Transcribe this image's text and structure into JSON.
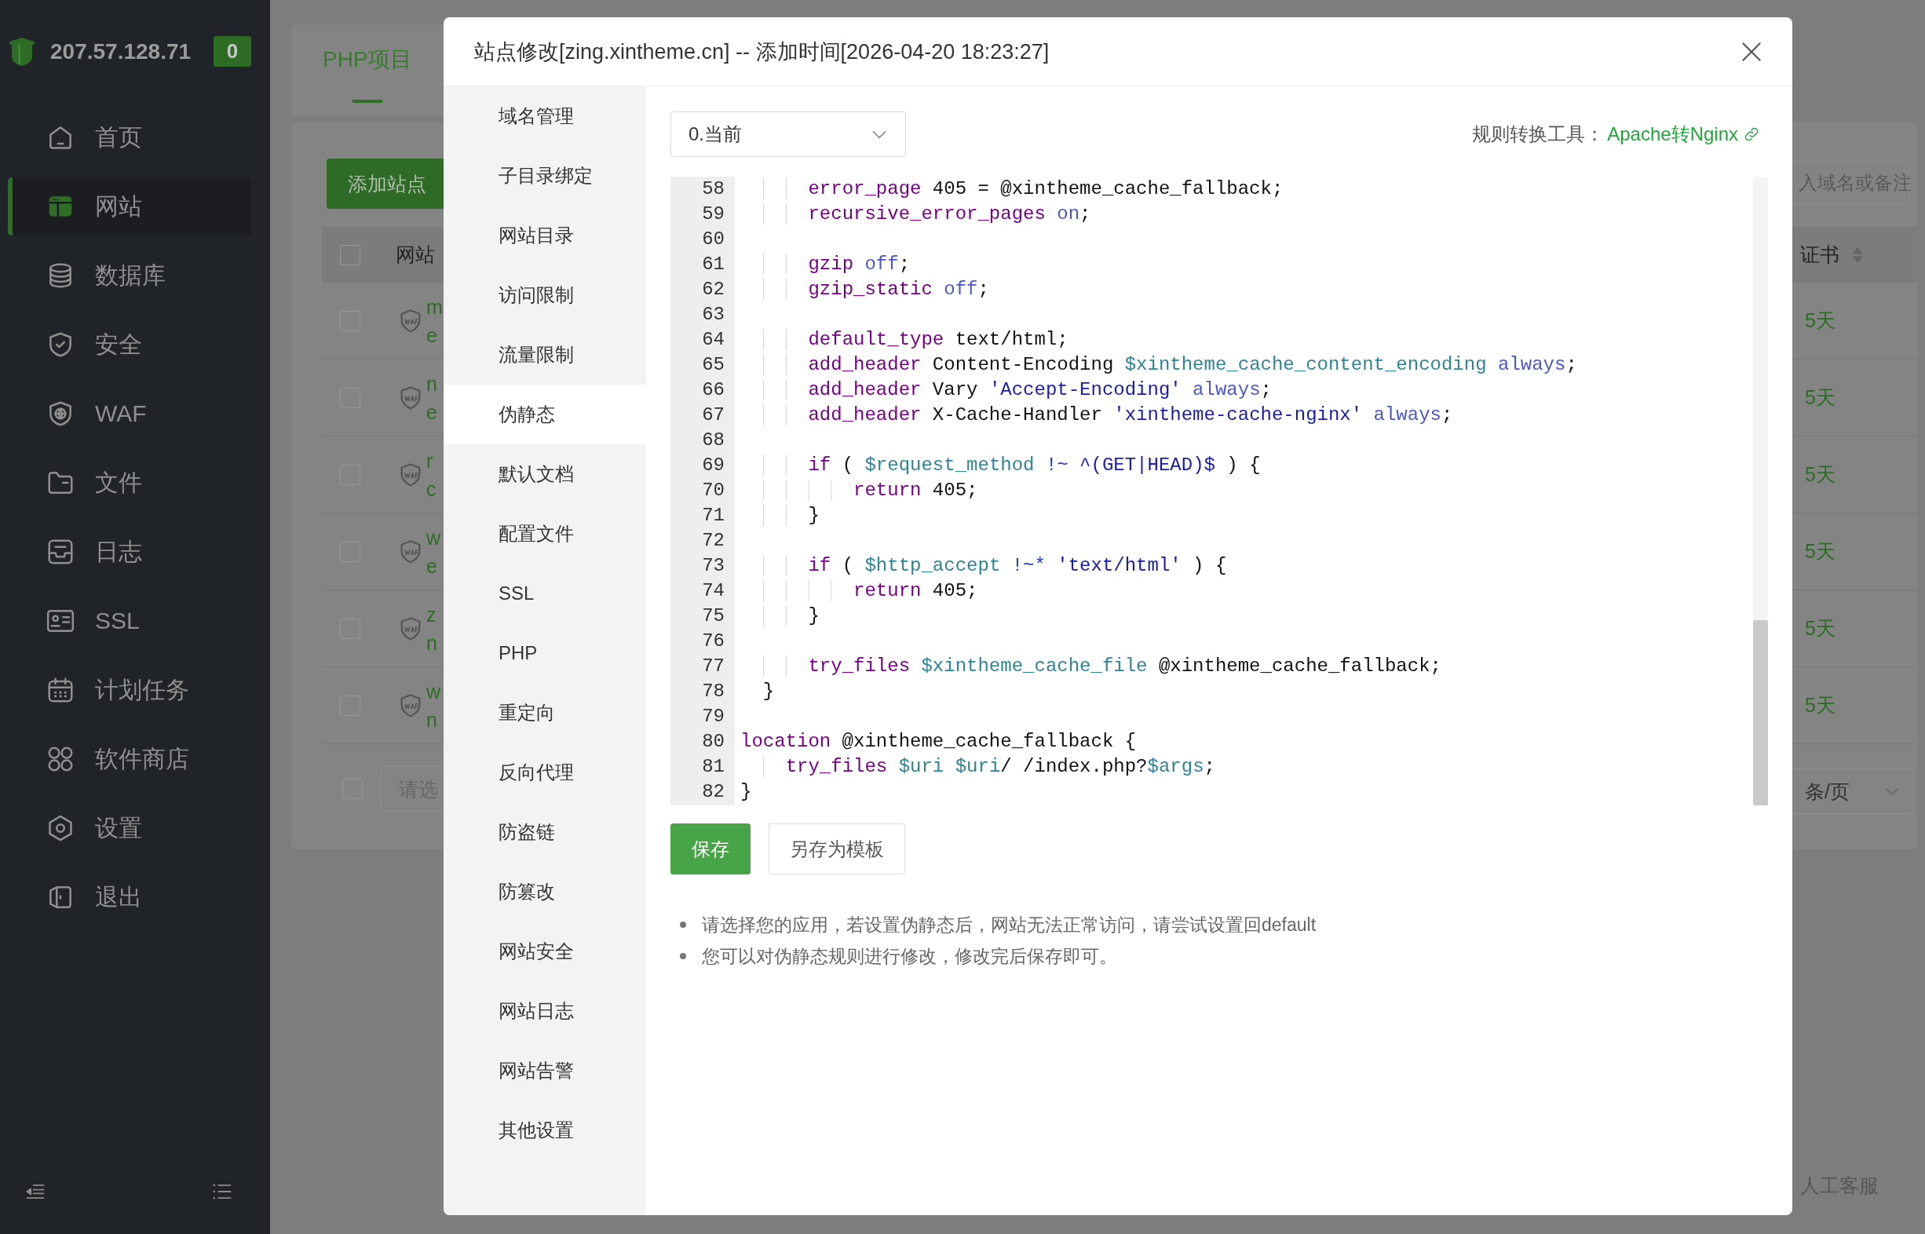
{
  "sidebar": {
    "server": "207.57.128.71",
    "badge": "0",
    "items": [
      {
        "label": "首页",
        "kind": "home",
        "selected": false
      },
      {
        "label": "网站",
        "kind": "site",
        "selected": true
      },
      {
        "label": "数据库",
        "kind": "database",
        "selected": false
      },
      {
        "label": "安全",
        "kind": "security",
        "selected": false
      },
      {
        "label": "WAF",
        "kind": "waf",
        "selected": false
      },
      {
        "label": "文件",
        "kind": "folder",
        "selected": false
      },
      {
        "label": "日志",
        "kind": "log",
        "selected": false
      },
      {
        "label": "SSL",
        "kind": "ssl",
        "selected": false
      },
      {
        "label": "计划任务",
        "kind": "calendar",
        "selected": false
      },
      {
        "label": "软件商店",
        "kind": "apps",
        "selected": false
      },
      {
        "label": "设置",
        "kind": "settings",
        "selected": false
      },
      {
        "label": "退出",
        "kind": "logout",
        "selected": false
      }
    ]
  },
  "background": {
    "tabs": [
      {
        "label": "PHP项目",
        "selected": true
      }
    ],
    "add_button": "添加站点",
    "search": {
      "placeholder": "入域名或备注"
    },
    "table": {
      "columns": [
        "网站",
        "证书"
      ],
      "header_checked": false,
      "rows": [
        {
          "name": "m",
          "note": "e",
          "ssl": "5天",
          "checked": false
        },
        {
          "name": "n",
          "note": "e",
          "ssl": "5天",
          "checked": false
        },
        {
          "name": "r",
          "note": "c",
          "ssl": "5天",
          "checked": false
        },
        {
          "name": "w",
          "note": "e",
          "ssl": "5天",
          "checked": false
        },
        {
          "name": "z",
          "note": "n",
          "ssl": "5天",
          "checked": false
        },
        {
          "name": "w",
          "note": "n",
          "ssl": "5天",
          "checked": false
        }
      ]
    },
    "batch": {
      "checked": false,
      "placeholder": "请选"
    },
    "page_size": "条/页",
    "support": "人工客服"
  },
  "modal": {
    "title": "站点修改[zing.xintheme.cn] -- 添加时间[2026-04-20 18:23:27]",
    "nav": [
      {
        "label": "域名管理",
        "selected": false
      },
      {
        "label": "子目录绑定",
        "selected": false
      },
      {
        "label": "网站目录",
        "selected": false
      },
      {
        "label": "访问限制",
        "selected": false
      },
      {
        "label": "流量限制",
        "selected": false
      },
      {
        "label": "伪静态",
        "selected": true
      },
      {
        "label": "默认文档",
        "selected": false
      },
      {
        "label": "配置文件",
        "selected": false
      },
      {
        "label": "SSL",
        "selected": false
      },
      {
        "label": "PHP",
        "selected": false
      },
      {
        "label": "重定向",
        "selected": false
      },
      {
        "label": "反向代理",
        "selected": false
      },
      {
        "label": "防盗链",
        "selected": false
      },
      {
        "label": "防篡改",
        "selected": false
      },
      {
        "label": "网站安全",
        "selected": false
      },
      {
        "label": "网站日志",
        "selected": false
      },
      {
        "label": "网站告警",
        "selected": false
      },
      {
        "label": "其他设置",
        "selected": false
      }
    ],
    "version": "0.当前",
    "converter_label": "规则转换工具：",
    "converter_link": "Apache转Nginx",
    "code": [
      {
        "number": "58",
        "tokens": [
          {
            "kind": "keyword",
            "text": "      error_page"
          },
          {
            "kind": "plain",
            "text": " 405 = @xintheme_cache_fallback;"
          }
        ]
      },
      {
        "number": "59",
        "tokens": [
          {
            "kind": "keyword",
            "text": "      recursive_error_pages"
          },
          {
            "kind": "atom",
            "text": " on"
          },
          {
            "kind": "plain",
            "text": ";"
          }
        ]
      },
      {
        "number": "60"
      },
      {
        "number": "61",
        "tokens": [
          {
            "kind": "keyword",
            "text": "      gzip"
          },
          {
            "kind": "atom",
            "text": " off"
          },
          {
            "kind": "plain",
            "text": ";"
          }
        ]
      },
      {
        "number": "62",
        "tokens": [
          {
            "kind": "keyword",
            "text": "      gzip_static"
          },
          {
            "kind": "atom",
            "text": " off"
          },
          {
            "kind": "plain",
            "text": ";"
          }
        ]
      },
      {
        "number": "63"
      },
      {
        "number": "64",
        "tokens": [
          {
            "kind": "keyword",
            "text": "      default_type"
          },
          {
            "kind": "plain",
            "text": " text/html;"
          }
        ]
      },
      {
        "number": "65",
        "tokens": [
          {
            "kind": "keyword",
            "text": "      add_header"
          },
          {
            "kind": "plain",
            "text": " Content-Encoding "
          },
          {
            "kind": "variable",
            "text": "$xintheme_cache_content_encoding"
          },
          {
            "kind": "atom",
            "text": " always"
          },
          {
            "kind": "plain",
            "text": ";"
          }
        ]
      },
      {
        "number": "66",
        "tokens": [
          {
            "kind": "keyword",
            "text": "      add_header"
          },
          {
            "kind": "plain",
            "text": " Vary "
          },
          {
            "kind": "string",
            "text": "'Accept-Encoding'"
          },
          {
            "kind": "atom",
            "text": " always"
          },
          {
            "kind": "plain",
            "text": ";"
          }
        ]
      },
      {
        "number": "67",
        "tokens": [
          {
            "kind": "keyword",
            "text": "      add_header"
          },
          {
            "kind": "plain",
            "text": " X-Cache-Handler "
          },
          {
            "kind": "string",
            "text": "'xintheme-cache-nginx'"
          },
          {
            "kind": "atom",
            "text": " always"
          },
          {
            "kind": "plain",
            "text": ";"
          }
        ]
      },
      {
        "number": "68"
      },
      {
        "number": "69",
        "tokens": [
          {
            "kind": "keyword",
            "text": "      if"
          },
          {
            "kind": "plain",
            "text": " ( "
          },
          {
            "kind": "variable",
            "text": "$request_method"
          },
          {
            "kind": "operator",
            "text": " !~"
          },
          {
            "kind": "string",
            "text": " ^(GET|HEAD)$"
          },
          {
            "kind": "plain",
            "text": " ) {"
          }
        ]
      },
      {
        "number": "70",
        "tokens": [
          {
            "kind": "keyword",
            "text": "          return"
          },
          {
            "kind": "plain",
            "text": " 405;"
          }
        ]
      },
      {
        "number": "71",
        "tokens": [
          {
            "kind": "plain",
            "text": "      }"
          }
        ]
      },
      {
        "number": "72"
      },
      {
        "number": "73",
        "tokens": [
          {
            "kind": "keyword",
            "text": "      if"
          },
          {
            "kind": "plain",
            "text": " ( "
          },
          {
            "kind": "variable",
            "text": "$http_accept"
          },
          {
            "kind": "operator",
            "text": " !~*"
          },
          {
            "kind": "string",
            "text": " 'text/html'"
          },
          {
            "kind": "plain",
            "text": " ) {"
          }
        ]
      },
      {
        "number": "74",
        "tokens": [
          {
            "kind": "keyword",
            "text": "          return"
          },
          {
            "kind": "plain",
            "text": " 405;"
          }
        ]
      },
      {
        "number": "75",
        "tokens": [
          {
            "kind": "plain",
            "text": "      }"
          }
        ]
      },
      {
        "number": "76"
      },
      {
        "number": "77",
        "tokens": [
          {
            "kind": "keyword",
            "text": "      try_files"
          },
          {
            "kind": "variable",
            "text": " $xintheme_cache_file"
          },
          {
            "kind": "plain",
            "text": " @xintheme_cache_fallback;"
          }
        ]
      },
      {
        "number": "78",
        "tokens": [
          {
            "kind": "plain",
            "text": "  }"
          }
        ]
      },
      {
        "number": "79"
      },
      {
        "number": "80",
        "tokens": [
          {
            "kind": "keyword",
            "text": "location"
          },
          {
            "kind": "plain",
            "text": " @xintheme_cache_fallback {"
          }
        ]
      },
      {
        "number": "81",
        "tokens": [
          {
            "kind": "keyword",
            "text": "    try_files"
          },
          {
            "kind": "variable",
            "text": " $uri"
          },
          {
            "kind": "variable",
            "text": " $uri"
          },
          {
            "kind": "plain",
            "text": "/ /index.php?"
          },
          {
            "kind": "variable",
            "text": "$args"
          },
          {
            "kind": "plain",
            "text": ";"
          }
        ]
      },
      {
        "number": "82",
        "tokens": [
          {
            "kind": "plain",
            "text": "}"
          }
        ]
      }
    ],
    "buttons": [
      {
        "label": "保存",
        "kind": "primary"
      },
      {
        "label": "另存为模板",
        "kind": "default"
      }
    ],
    "notes": [
      "请选择您的应用，若设置伪静态后，网站无法正常访问，请尝试设置回default",
      "您可以对伪静态规则进行修改，修改完后保存即可。"
    ]
  }
}
